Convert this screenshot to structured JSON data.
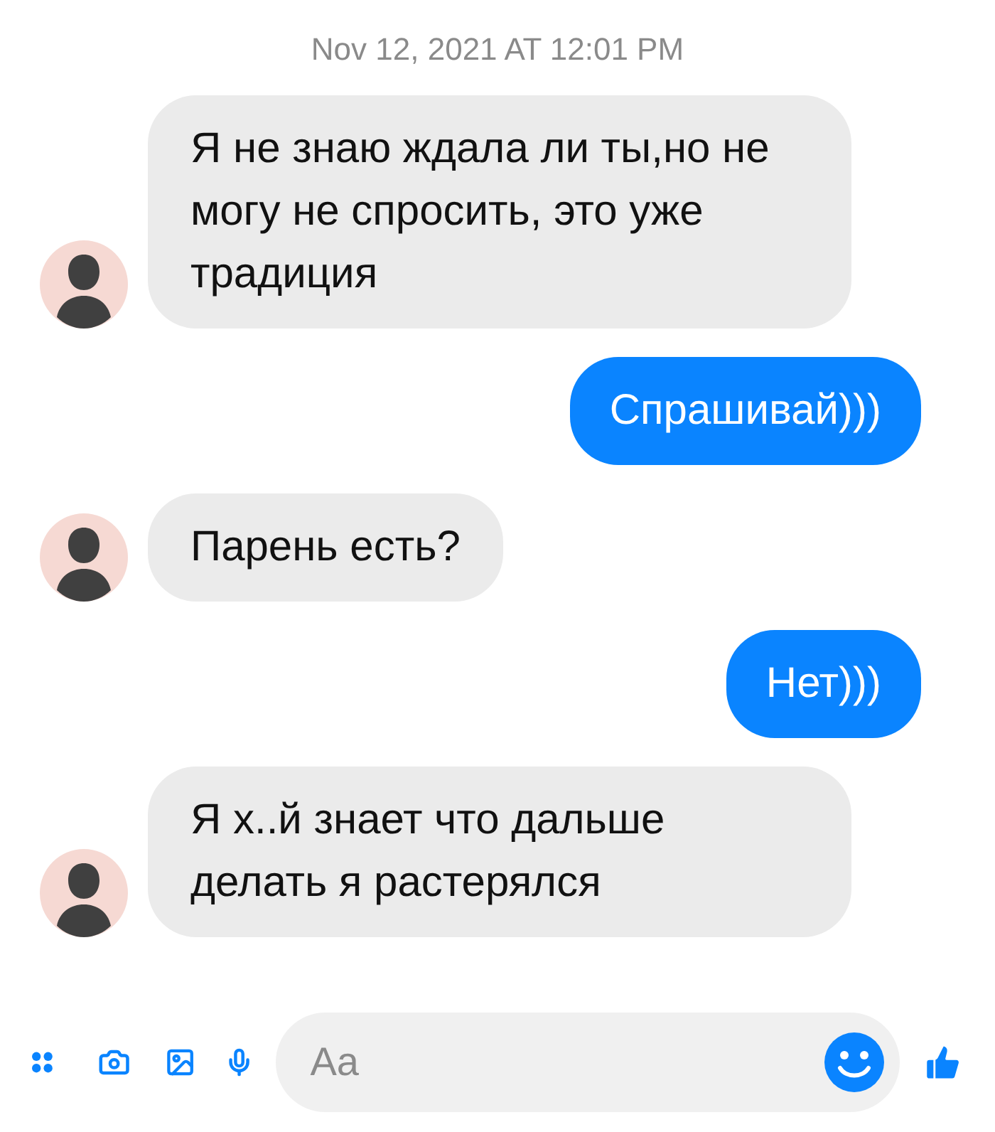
{
  "timestamp": "Nov 12, 2021 AT 12:01 PM",
  "messages": [
    {
      "kind": "incoming",
      "text": "Я не знаю ждала ли ты,но не могу не спросить, это уже традиция"
    },
    {
      "kind": "outgoing",
      "text": "Спрашивай)))"
    },
    {
      "kind": "incoming",
      "text": "Парень есть?"
    },
    {
      "kind": "outgoing",
      "text": "Нет)))"
    },
    {
      "kind": "incoming",
      "text": "Я х..й знает что дальше делать я растерялся"
    }
  ],
  "composer": {
    "placeholder": "Aa"
  }
}
